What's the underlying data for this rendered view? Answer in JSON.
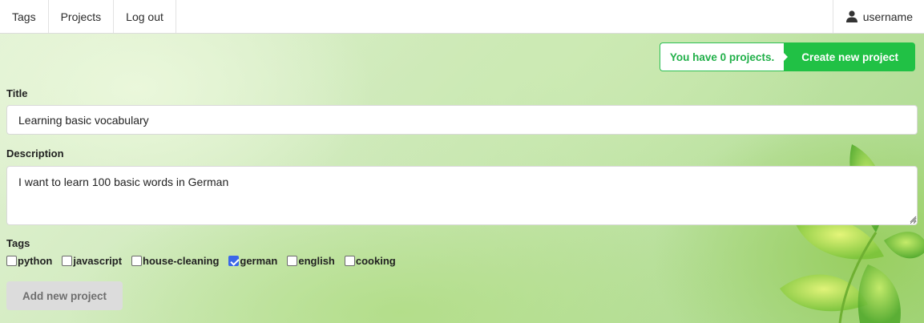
{
  "nav": {
    "items": [
      {
        "label": "Tags"
      },
      {
        "label": "Projects"
      },
      {
        "label": "Log out"
      }
    ],
    "username": "username"
  },
  "banner": {
    "count_text": "You have 0 projects.",
    "create_label": "Create new project"
  },
  "form": {
    "title_label": "Title",
    "title_value": "Learning basic vocabulary",
    "description_label": "Description",
    "description_value": "I want to learn 100 basic words in German",
    "tags_label": "Tags",
    "tags": [
      {
        "label": "python",
        "checked": false
      },
      {
        "label": "javascript",
        "checked": false
      },
      {
        "label": "house-cleaning",
        "checked": false
      },
      {
        "label": "german",
        "checked": true
      },
      {
        "label": "english",
        "checked": false
      },
      {
        "label": "cooking",
        "checked": false
      }
    ],
    "submit_label": "Add new project"
  },
  "colors": {
    "accent": "#21c145",
    "checkbox_checked": "#3b67e8",
    "disabled_button": "#dcdcdc"
  },
  "icons": {
    "user": "user-icon",
    "checkbox_checked": "checkbox-checked-icon"
  }
}
